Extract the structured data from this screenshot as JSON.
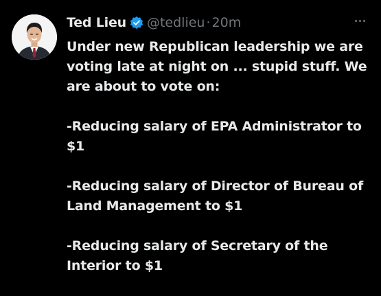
{
  "tweet": {
    "author_name": "Ted Lieu",
    "handle": "@tedlieu",
    "separator": "·",
    "time": "20m",
    "verified_icon": "verified-badge-icon",
    "more_icon": "more-options-icon",
    "paragraphs": [
      "Under new Republican leadership we are voting late at night on ... stupid stuff. We are about to vote on:",
      "-Reducing salary of EPA Administrator to $1",
      "-Reducing salary of Director of Bureau of Land Management to $1",
      "-Reducing salary of Secretary of the Interior to $1"
    ]
  },
  "colors": {
    "background": "#000000",
    "text": "#e7e9ea",
    "secondary": "#71767b",
    "verified": "#1d9bf0"
  }
}
